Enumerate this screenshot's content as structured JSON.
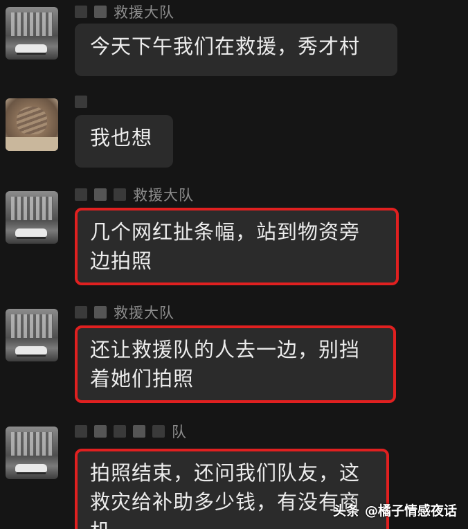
{
  "messages": [
    {
      "sender": "救援大队",
      "text": "今天下午我们在救援，秀才村"
    },
    {
      "sender": "",
      "text": "我也想"
    },
    {
      "sender": "救援大队",
      "text_lines": [
        "几个网红扯条幅，站到物资旁",
        "边拍照"
      ]
    },
    {
      "sender": "救援大队",
      "text_lines": [
        "还让救援队的人去一边，别挡",
        "着她们拍照"
      ]
    },
    {
      "sender": "队",
      "text_lines": [
        "拍照结束，还问我们队友，这",
        "救灾给补助多少钱，有没有商",
        "机"
      ]
    }
  ],
  "watermark": {
    "platform": "头条",
    "account": "@橘子情感夜话"
  },
  "colors": {
    "highlight": "#e02020",
    "bubble": "#2b2b2b",
    "background": "#151515"
  }
}
